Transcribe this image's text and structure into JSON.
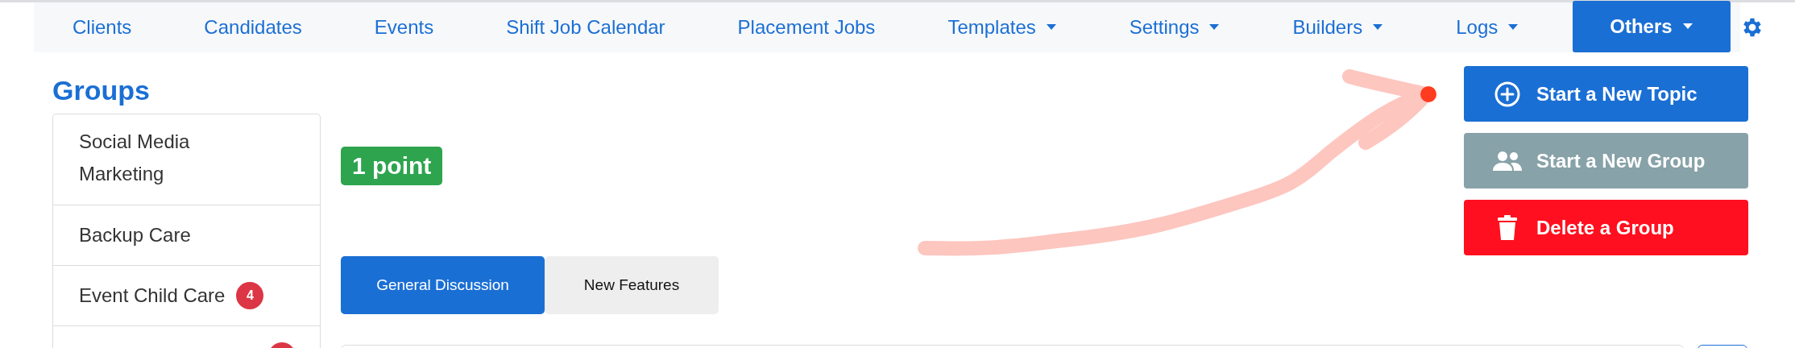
{
  "nav": {
    "items": [
      {
        "label": "Clients",
        "dropdown": false,
        "selected": false
      },
      {
        "label": "Candidates",
        "dropdown": false,
        "selected": false
      },
      {
        "label": "Events",
        "dropdown": false,
        "selected": false
      },
      {
        "label": "Shift Job Calendar",
        "dropdown": false,
        "selected": false
      },
      {
        "label": "Placement Jobs",
        "dropdown": false,
        "selected": false
      },
      {
        "label": "Templates",
        "dropdown": true,
        "selected": false
      },
      {
        "label": "Settings",
        "dropdown": true,
        "selected": false
      },
      {
        "label": "Builders",
        "dropdown": true,
        "selected": false
      },
      {
        "label": "Logs",
        "dropdown": true,
        "selected": false
      },
      {
        "label": "Others",
        "dropdown": true,
        "selected": true
      }
    ]
  },
  "sidebar": {
    "title": "Groups",
    "items": [
      {
        "label": "Social Media Marketing"
      },
      {
        "label": "Backup Care"
      },
      {
        "label": "Event Child Care",
        "badge": "4"
      },
      {
        "kind": "cut",
        "badge_shown": true
      }
    ]
  },
  "points": "1 point",
  "tabs": [
    {
      "label": "General Discussion",
      "selected": true
    },
    {
      "label": "New Features",
      "selected": false
    }
  ],
  "actions": [
    {
      "kind": "topic",
      "label": "Start a New Topic"
    },
    {
      "kind": "group",
      "label": "Start a New Group"
    },
    {
      "kind": "delete",
      "label": "Delete a Group"
    }
  ]
}
